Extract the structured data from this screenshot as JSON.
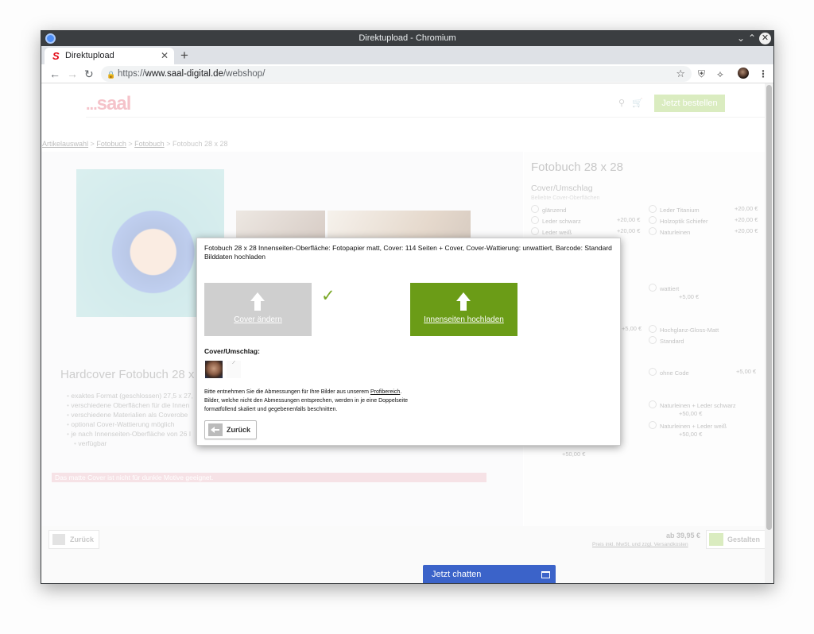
{
  "window": {
    "title": "Direktupload - Chromium"
  },
  "tab": {
    "title": "Direktupload",
    "favicon": "S"
  },
  "address": {
    "scheme": "https://",
    "host": "www.saal-digital.de",
    "path": "/webshop/"
  },
  "header": {
    "logo_dots": "...",
    "logo_text": "saal",
    "order_button": "Jetzt bestellen",
    "accent": "#8dc63f"
  },
  "breadcrumb": {
    "items": [
      "Artikelauswahl",
      "Fotobuch",
      "Fotobuch",
      "Fotobuch 28 x 28"
    ],
    "sep": ">"
  },
  "product": {
    "title": "Hardcover Fotobuch 28 x",
    "bullets": [
      "exaktes Format (geschlossen) 27,5 x 27,",
      "verschiedene Oberflächen für die Innen",
      "verschiedene Materialien als Coverobe",
      "optional Cover-Wattierung möglich",
      "je nach Innenseiten-Oberfläche von 26 I",
      "verfügbar"
    ],
    "warning": "Das matte Cover ist nicht für dunkle Motive geeignet."
  },
  "config": {
    "title": "Fotobuch 28 x 28",
    "section": "Cover/Umschlag",
    "hint": "Beliebte Cover-Oberflächen",
    "options_left": [
      {
        "label": "glänzend",
        "price": ""
      },
      {
        "label": "Leder schwarz",
        "price": "+20,00 €"
      },
      {
        "label": "Leder weiß",
        "price": "+20,00 €"
      }
    ],
    "options_right": [
      {
        "label": "Leder Titanium",
        "price": "+20,00 €"
      },
      {
        "label": "Holzoptik Schiefer",
        "price": "+20,00 €"
      },
      {
        "label": "Naturleinen",
        "price": "+20,00 €"
      }
    ],
    "wattiert": {
      "label": "wattiert",
      "price": "+5,00 €"
    },
    "price_mid": "+5,00 €",
    "hochglanz": "Hochglanz-Gloss-Matt",
    "barcode": "Standard",
    "ohne_code": {
      "label": "ohne Code",
      "price": "+5,00 €"
    },
    "natur1": {
      "label": "Naturleinen + Leder schwarz",
      "price": "+50,00 €"
    },
    "natur2": {
      "label": "Naturleinen + Leder weiß",
      "price": "+50,00 €"
    },
    "extra_price": "+50,00 €"
  },
  "footer": {
    "back": "Zurück",
    "price": "ab 39,95 €",
    "price_note": "Preis inkl. MwSt. und zzgl. Versandkosten",
    "next": "Gestalten"
  },
  "modal": {
    "heading": "Fotobuch 28 x 28 Innenseiten-Oberfläche: Fotopapier matt, Cover: 114 Seiten + Cover, Cover-Wattierung: unwattiert, Barcode: Standard",
    "subheading": "Bilddaten hochladen",
    "cover_button": "Cover ändern",
    "inner_button": "Innenseiten hochladen",
    "cover_label": "Cover/Umschlag:",
    "info_line1_a": "Bitte entnehmen Sie die Abmessungen für Ihre Bilder aus unserem ",
    "info_link": "Profibereich",
    "info_line1_b": ".",
    "info_line2": "Bilder, welche nicht den Abmessungen entsprechen, werden in je eine Doppelseite",
    "info_line3": "formatfüllend skaliert und gegebenenfalls beschnitten.",
    "back_button": "Zurück",
    "green": "#6b9c17"
  },
  "chat": {
    "label": "Jetzt chatten",
    "color": "#3b63c9"
  }
}
